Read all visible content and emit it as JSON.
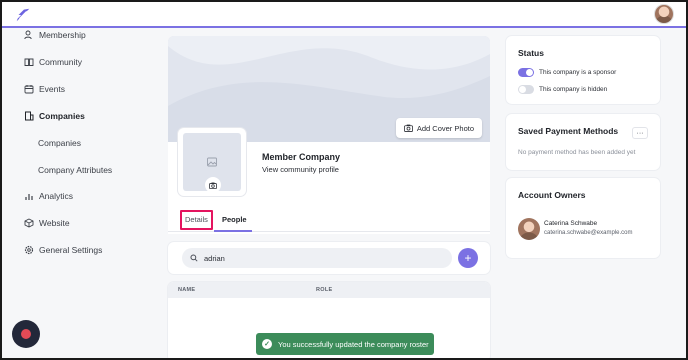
{
  "topbar": {
    "logo_icon": "feather-logo-icon",
    "avatar_icon": "user-avatar"
  },
  "sidebar": {
    "items": [
      {
        "label": "Membership",
        "icon": "users-icon"
      },
      {
        "label": "Community",
        "icon": "book-open-icon"
      },
      {
        "label": "Events",
        "icon": "calendar-icon"
      },
      {
        "label": "Companies",
        "icon": "building-icon",
        "active": true
      },
      {
        "label": "Companies",
        "sub": true
      },
      {
        "label": "Company Attributes",
        "sub": true
      },
      {
        "label": "Analytics",
        "icon": "bar-chart-icon"
      },
      {
        "label": "Website",
        "icon": "cube-icon"
      },
      {
        "label": "General Settings",
        "icon": "gear-icon"
      }
    ]
  },
  "profile": {
    "add_cover_label": "Add Cover Photo",
    "company_name": "Member Company",
    "view_profile_label": "View community profile",
    "tabs": [
      "Details",
      "People"
    ],
    "active_tab": "People"
  },
  "search": {
    "value": "adrian"
  },
  "table": {
    "columns": [
      "NAME",
      "ROLE"
    ]
  },
  "toast": {
    "message": "You successfully updated the company roster"
  },
  "status": {
    "title": "Status",
    "toggles": [
      {
        "label": "This company is a sponsor",
        "on": true
      },
      {
        "label": "This company is hidden",
        "on": false
      }
    ]
  },
  "payment": {
    "title": "Saved Payment Methods",
    "more_label": "···",
    "empty_text": "No payment method has been added yet"
  },
  "owners": {
    "title": "Account Owners",
    "name": "Caterina Schwabe",
    "email": "caterina.schwabe@example.com"
  },
  "colors": {
    "accent": "#7b71e3",
    "toast": "#3c8c5a",
    "highlight": "#e4145f"
  }
}
